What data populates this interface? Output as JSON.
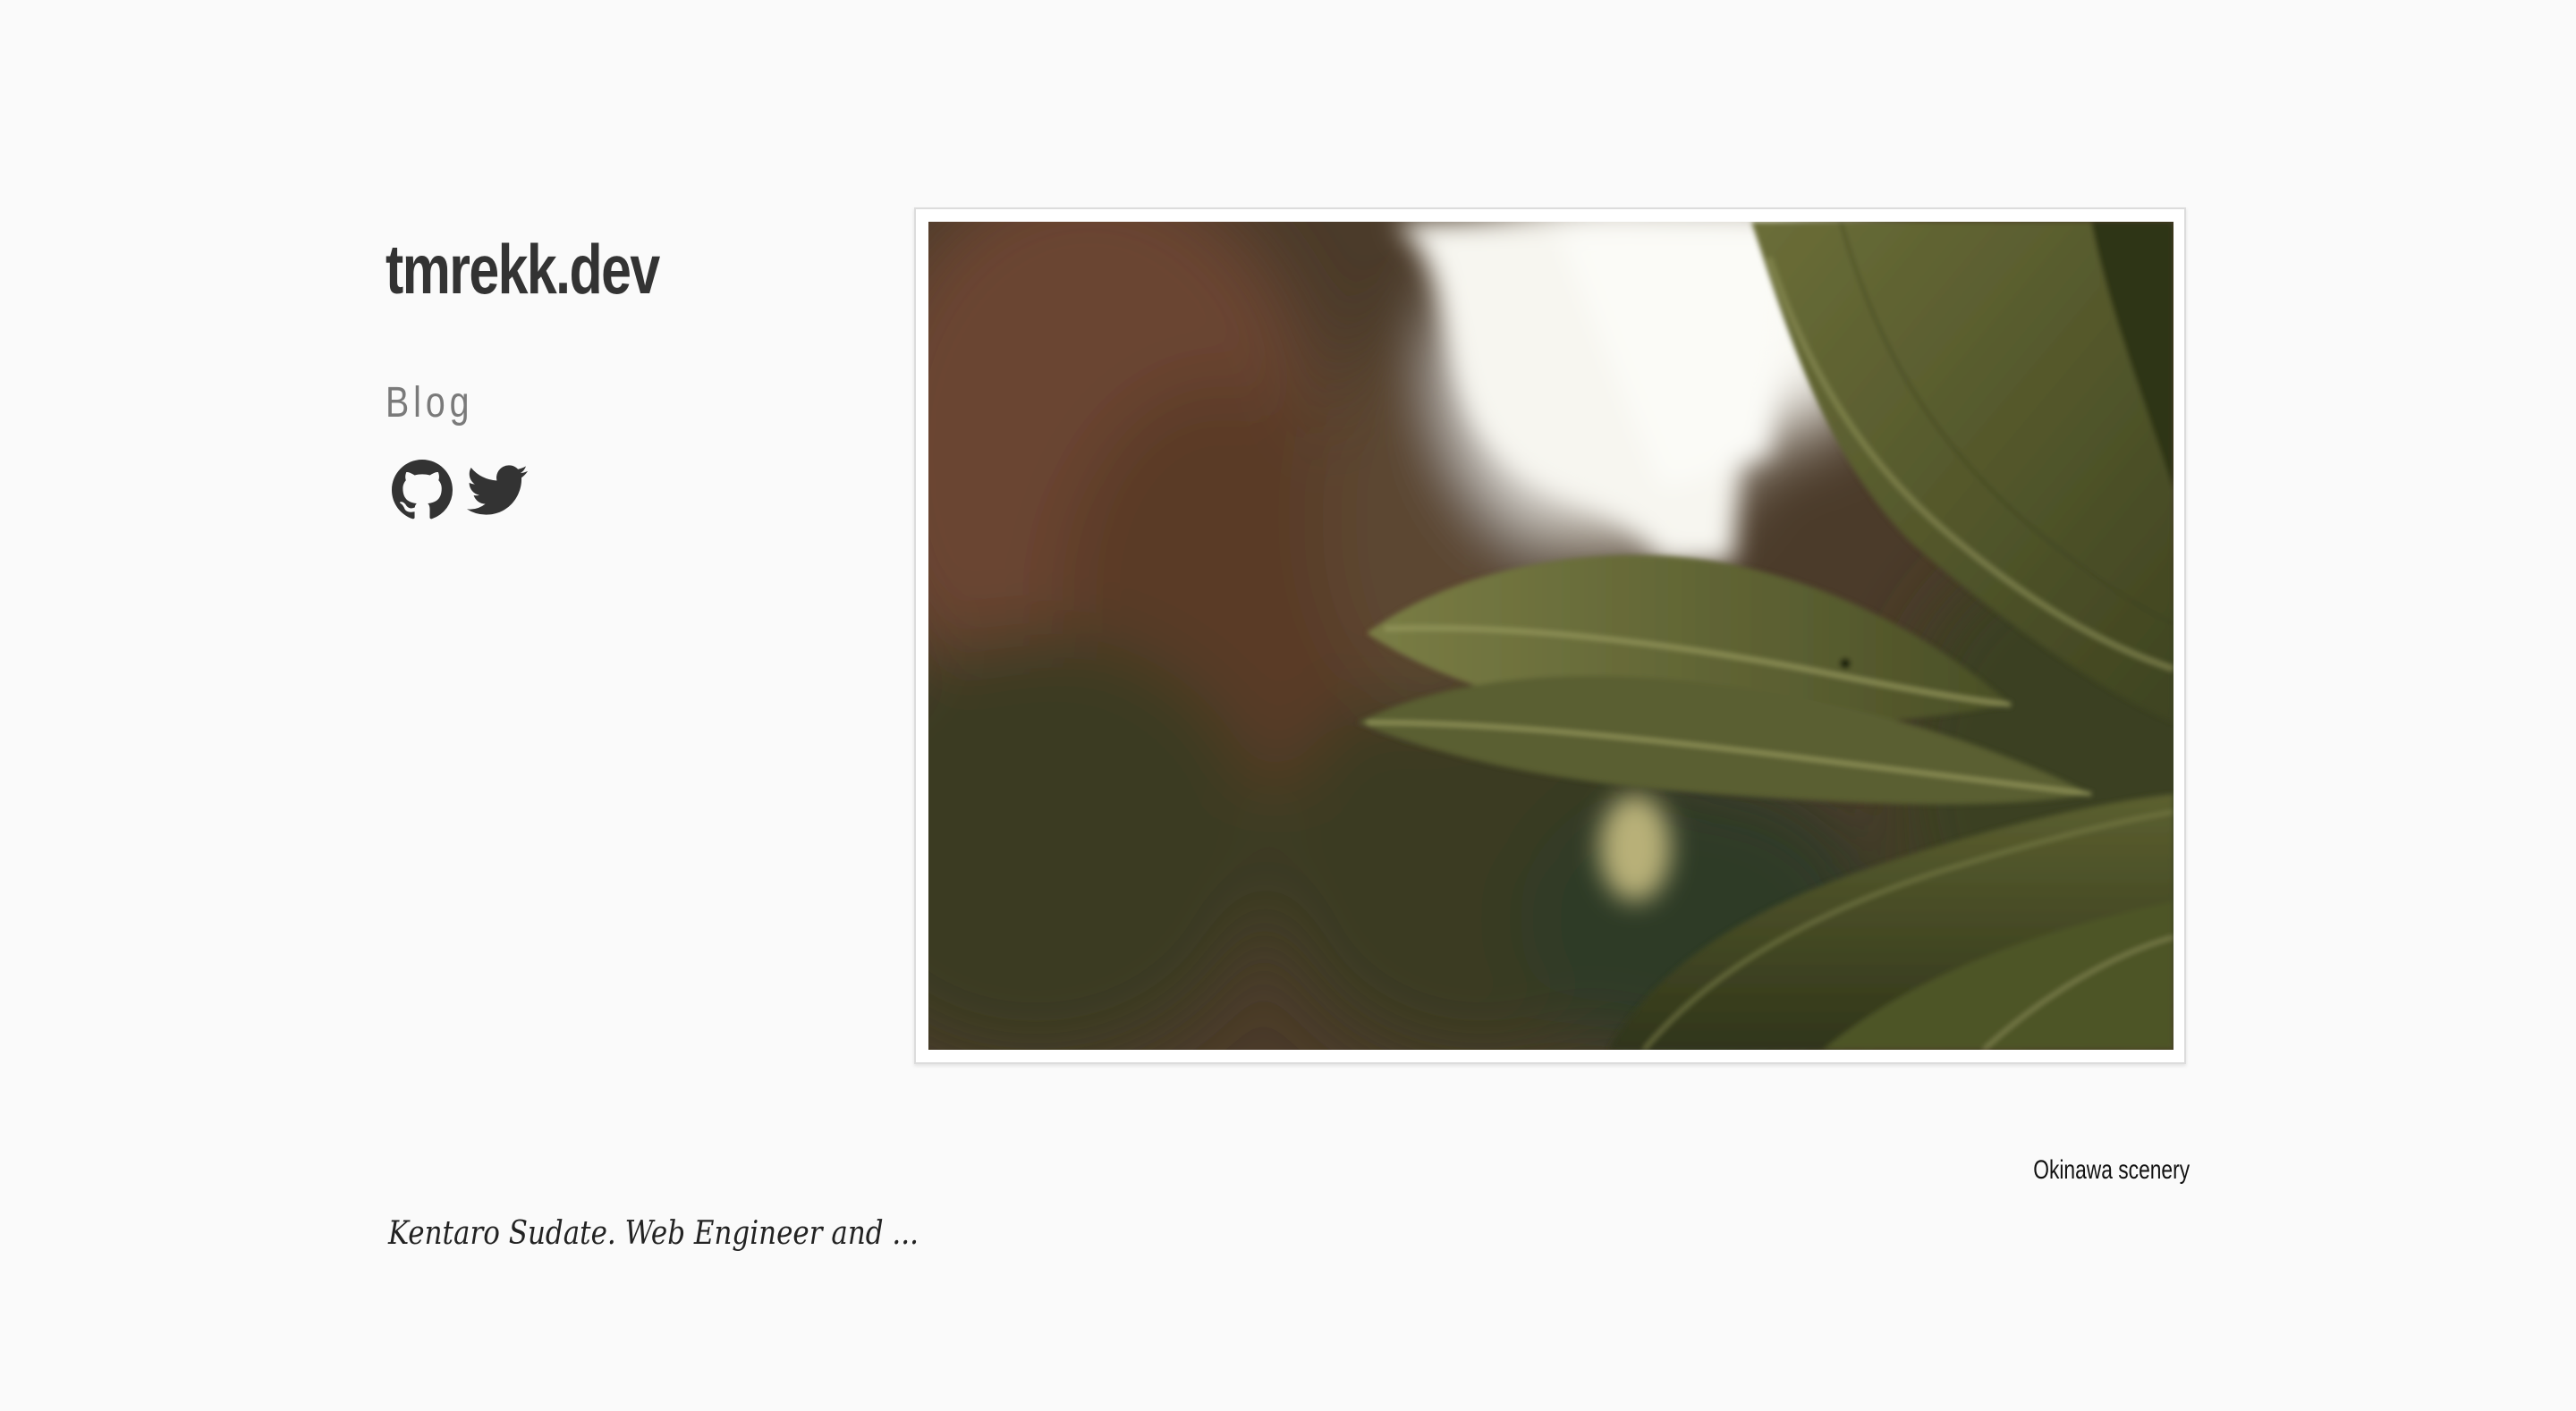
{
  "site": {
    "title": "tmrekk.dev"
  },
  "nav": {
    "blog_label": "Blog"
  },
  "social": {
    "github_icon": "github-icon",
    "twitter_icon": "twitter-icon"
  },
  "hero": {
    "image_icon": "okinawa-leaves-photo",
    "caption": "Okinawa scenery"
  },
  "footer": {
    "tagline": "Kentaro Sudate. Web Engineer and ..."
  },
  "colors": {
    "background": "#fafafa",
    "text": "#333333",
    "nav_text": "#7a7a7a"
  }
}
